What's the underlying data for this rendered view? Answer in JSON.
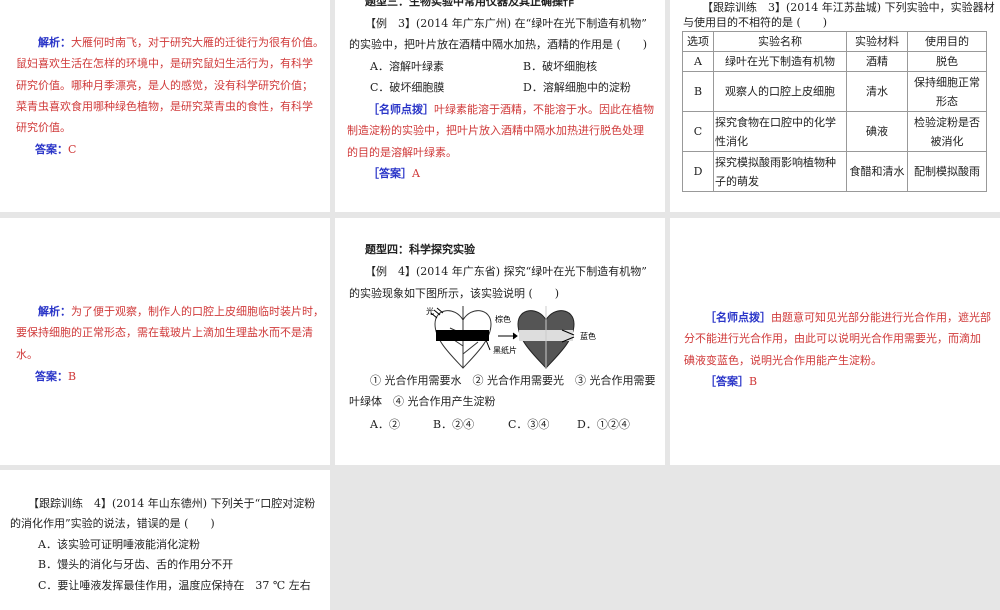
{
  "slides": [
    {
      "label": "解析：",
      "lines": [
        "大雁何时南飞，对于研究大雁的迁徙行为很有价值。",
        "鼠妇喜欢生活在怎样的环境中，是研究鼠妇生活行为，有科学",
        "研究价值。哪种月季漂亮，是人的感觉，没有科学研究价值；",
        "菜青虫喜欢食用哪种绿色植物，是研究菜青虫的食性，有科学",
        "研究价值。"
      ],
      "answer_label": "答案：",
      "answer": "C"
    },
    {
      "title": "题型三：生物实验中常用仪器及其正确操作",
      "q": [
        "【例　3】(2014 年广东广州) 在“绿叶在光下制造有机物”",
        "的实验中，把叶片放在酒精中隔水加热，酒精的作用是 (　　)"
      ],
      "options": [
        "A．溶解叶绿素",
        "B．破坏细胞核",
        "C．破坏细胞膜",
        "D．溶解细胞中的淀粉"
      ],
      "tip_label": "［名师点拨］",
      "tip": [
        "叶绿素能溶于酒精，不能溶于水。因此在植物",
        "制造淀粉的实验中，把叶片放入酒精中隔水加热进行脱色处理",
        "的目的是溶解叶绿素。"
      ],
      "answer_label": "［答案］",
      "answer": "A"
    },
    {
      "q": [
        "【跟踪训练　3】(2014 年江苏盐城) 下列实验中，实验器材",
        "与使用目的不相符的是 (　　)"
      ],
      "table": {
        "headers": [
          "选项",
          "实验名称",
          "实验材料",
          "使用目的"
        ],
        "rows": [
          [
            "A",
            "绿叶在光下制造有机物",
            "酒精",
            "脱色"
          ],
          [
            "B",
            "观察人的口腔上皮细胞",
            "清水",
            "保持细胞正常形态"
          ],
          [
            "C",
            "探究食物在口腔中的化学性消化",
            "碘液",
            "检验淀粉是否被消化"
          ],
          [
            "D",
            "探究模拟酸雨影响植物种子的萌发",
            "食醋和清水",
            "配制模拟酸雨"
          ]
        ]
      }
    },
    {
      "label": "解析：",
      "lines": [
        "为了便于观察，制作人的口腔上皮细胞临时装片时，",
        "要保持细胞的正常形态，需在载玻片上滴加生理盐水而不是清",
        "水。"
      ],
      "answer_label": "答案：",
      "answer": "B"
    },
    {
      "title": "题型四：科学探究实验",
      "q": [
        "【例　4】(2014 年广东省) 探究“绿叶在光下制造有机物”",
        "的实验现象如下图所示，该实验说明 (　　)"
      ],
      "figure": {
        "light": "光",
        "brown": "棕色",
        "paper": "黑纸片",
        "blue": "蓝色"
      },
      "stmts": [
        "① 光合作用需要水　② 光合作用需要光　③ 光合作用需要",
        "叶绿体　④ 光合作用产生淀粉"
      ],
      "options": [
        "A．②",
        "B．②④",
        "C．③④",
        "D．①②④"
      ]
    },
    {
      "tip_label": "［名师点拨］",
      "tip": [
        "由题意可知见光部分能进行光合作用，遮光部",
        "分不能进行光合作用，由此可以说明光合作用需要光，而滴加",
        "碘液变蓝色，说明光合作用能产生淀粉。"
      ],
      "answer_label": "［答案］",
      "answer": "B"
    },
    {
      "q": [
        "【跟踪训练　4】(2014 年山东德州) 下列关于“口腔对淀粉",
        "的消化作用”实验的说法，错误的是 (　　)"
      ],
      "options": [
        "A．该实验可证明唾液能消化淀粉",
        "B．馒头的消化与牙齿、舌的作用分不开",
        "C．要让唾液发挥最佳作用，温度应保持在　37 ℃ 左右"
      ]
    }
  ]
}
